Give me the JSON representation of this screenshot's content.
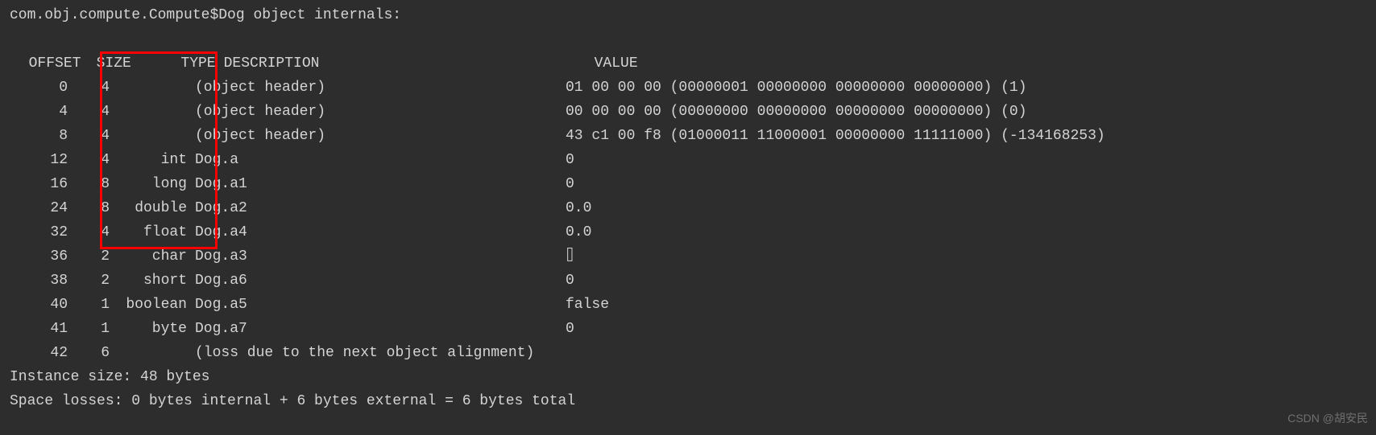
{
  "title": "com.obj.compute.Compute$Dog object internals:",
  "headers": {
    "offset": "OFFSET",
    "size": "SIZE",
    "type": "TYPE",
    "description": "DESCRIPTION",
    "value": "VALUE"
  },
  "rows": [
    {
      "offset": "0",
      "size": "4",
      "type": "",
      "description": "(object header)",
      "value": "01 00 00 00 (00000001 00000000 00000000 00000000) (1)"
    },
    {
      "offset": "4",
      "size": "4",
      "type": "",
      "description": "(object header)",
      "value": "00 00 00 00 (00000000 00000000 00000000 00000000) (0)"
    },
    {
      "offset": "8",
      "size": "4",
      "type": "",
      "description": "(object header)",
      "value": "43 c1 00 f8 (01000011 11000001 00000000 11111000) (-134168253)"
    },
    {
      "offset": "12",
      "size": "4",
      "type": "int",
      "description": "Dog.a",
      "value": "0"
    },
    {
      "offset": "16",
      "size": "8",
      "type": "long",
      "description": "Dog.a1",
      "value": "0"
    },
    {
      "offset": "24",
      "size": "8",
      "type": "double",
      "description": "Dog.a2",
      "value": "0.0"
    },
    {
      "offset": "32",
      "size": "4",
      "type": "float",
      "description": "Dog.a4",
      "value": "0.0"
    },
    {
      "offset": "36",
      "size": "2",
      "type": "char",
      "description": "Dog.a3",
      "value": "⌷"
    },
    {
      "offset": "38",
      "size": "2",
      "type": "short",
      "description": "Dog.a6",
      "value": "0"
    },
    {
      "offset": "40",
      "size": "1",
      "type": "boolean",
      "description": "Dog.a5",
      "value": "false"
    },
    {
      "offset": "41",
      "size": "1",
      "type": "byte",
      "description": "Dog.a7",
      "value": "0"
    },
    {
      "offset": "42",
      "size": "6",
      "type": "",
      "description": "(loss due to the next object alignment)",
      "value": ""
    }
  ],
  "footer": {
    "instance_size": "Instance size: 48 bytes",
    "space_losses": "Space losses: 0 bytes internal + 6 bytes external = 6 bytes total"
  },
  "watermark": "CSDN @胡安民"
}
